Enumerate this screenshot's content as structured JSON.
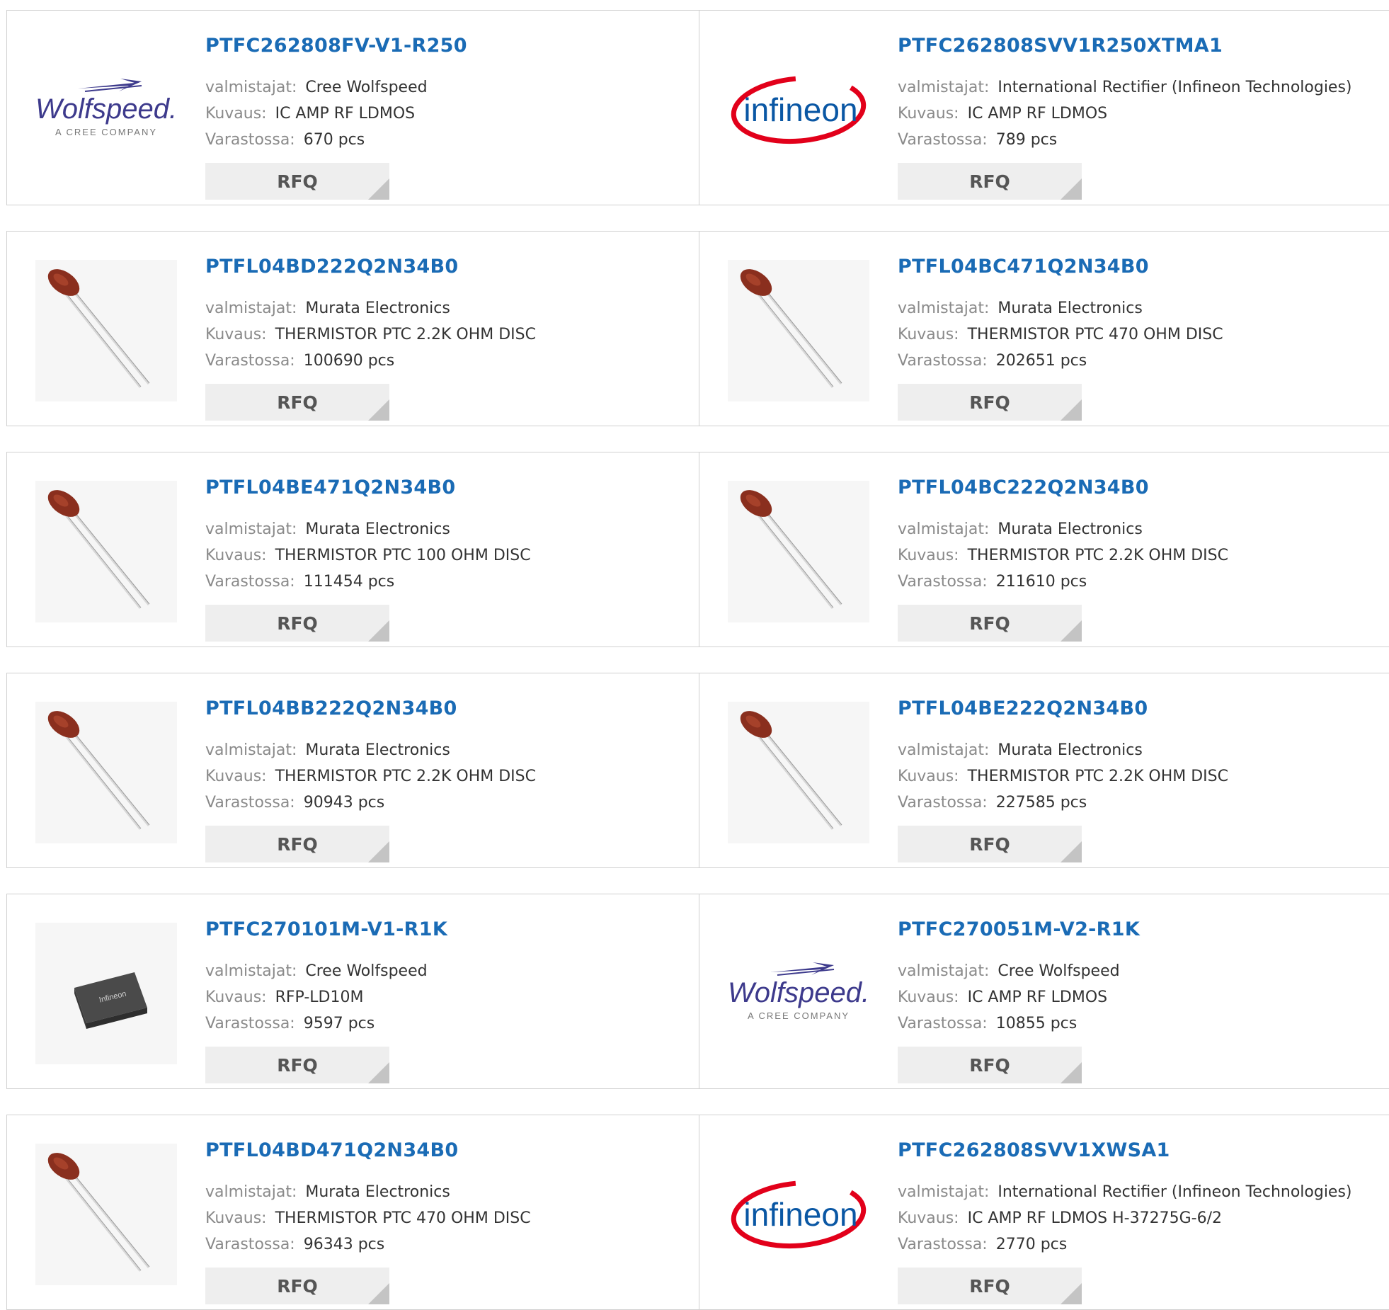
{
  "labels": {
    "manufacturer": "valmistajat:",
    "description": "Kuvaus:",
    "stock": "Varastossa:",
    "rfq": "RFQ"
  },
  "logo_text": {
    "wolfspeed": "Wolfspeed.",
    "wolfspeed_sub": "A CREE COMPANY",
    "infineon": "infineon",
    "chip": "Infineon"
  },
  "colors": {
    "title": "#1a6bb5",
    "label": "#8a8a8a",
    "value": "#333333",
    "button_bg": "#eeeeee",
    "border": "#d0d0d0"
  },
  "products": [
    {
      "part": "PTFC262808FV-V1-R250",
      "manufacturer": "Cree Wolfspeed",
      "description": "IC AMP RF LDMOS",
      "stock": "670 pcs",
      "image": "wolfspeed-logo"
    },
    {
      "part": "PTFC262808SVV1R250XTMA1",
      "manufacturer": "International Rectifier (Infineon Technologies)",
      "description": "IC AMP RF LDMOS",
      "stock": "789 pcs",
      "image": "infineon-logo"
    },
    {
      "part": "PTFL04BD222Q2N34B0",
      "manufacturer": "Murata Electronics",
      "description": "THERMISTOR PTC 2.2K OHM DISC",
      "stock": "100690 pcs",
      "image": "thermistor"
    },
    {
      "part": "PTFL04BC471Q2N34B0",
      "manufacturer": "Murata Electronics",
      "description": "THERMISTOR PTC 470 OHM DISC",
      "stock": "202651 pcs",
      "image": "thermistor"
    },
    {
      "part": "PTFL04BE471Q2N34B0",
      "manufacturer": "Murata Electronics",
      "description": "THERMISTOR PTC 100 OHM DISC",
      "stock": "111454 pcs",
      "image": "thermistor"
    },
    {
      "part": "PTFL04BC222Q2N34B0",
      "manufacturer": "Murata Electronics",
      "description": "THERMISTOR PTC 2.2K OHM DISC",
      "stock": "211610 pcs",
      "image": "thermistor"
    },
    {
      "part": "PTFL04BB222Q2N34B0",
      "manufacturer": "Murata Electronics",
      "description": "THERMISTOR PTC 2.2K OHM DISC",
      "stock": "90943 pcs",
      "image": "thermistor"
    },
    {
      "part": "PTFL04BE222Q2N34B0",
      "manufacturer": "Murata Electronics",
      "description": "THERMISTOR PTC 2.2K OHM DISC",
      "stock": "227585 pcs",
      "image": "thermistor"
    },
    {
      "part": "PTFC270101M-V1-R1K",
      "manufacturer": "Cree Wolfspeed",
      "description": "RFP-LD10M",
      "stock": "9597 pcs",
      "image": "chip"
    },
    {
      "part": "PTFC270051M-V2-R1K",
      "manufacturer": "Cree Wolfspeed",
      "description": "IC AMP RF LDMOS",
      "stock": "10855 pcs",
      "image": "wolfspeed-logo"
    },
    {
      "part": "PTFL04BD471Q2N34B0",
      "manufacturer": "Murata Electronics",
      "description": "THERMISTOR PTC 470 OHM DISC",
      "stock": "96343 pcs",
      "image": "thermistor"
    },
    {
      "part": "PTFC262808SVV1XWSA1",
      "manufacturer": "International Rectifier (Infineon Technologies)",
      "description": "IC AMP RF LDMOS H-37275G-6/2",
      "stock": "2770 pcs",
      "image": "infineon-logo"
    }
  ]
}
